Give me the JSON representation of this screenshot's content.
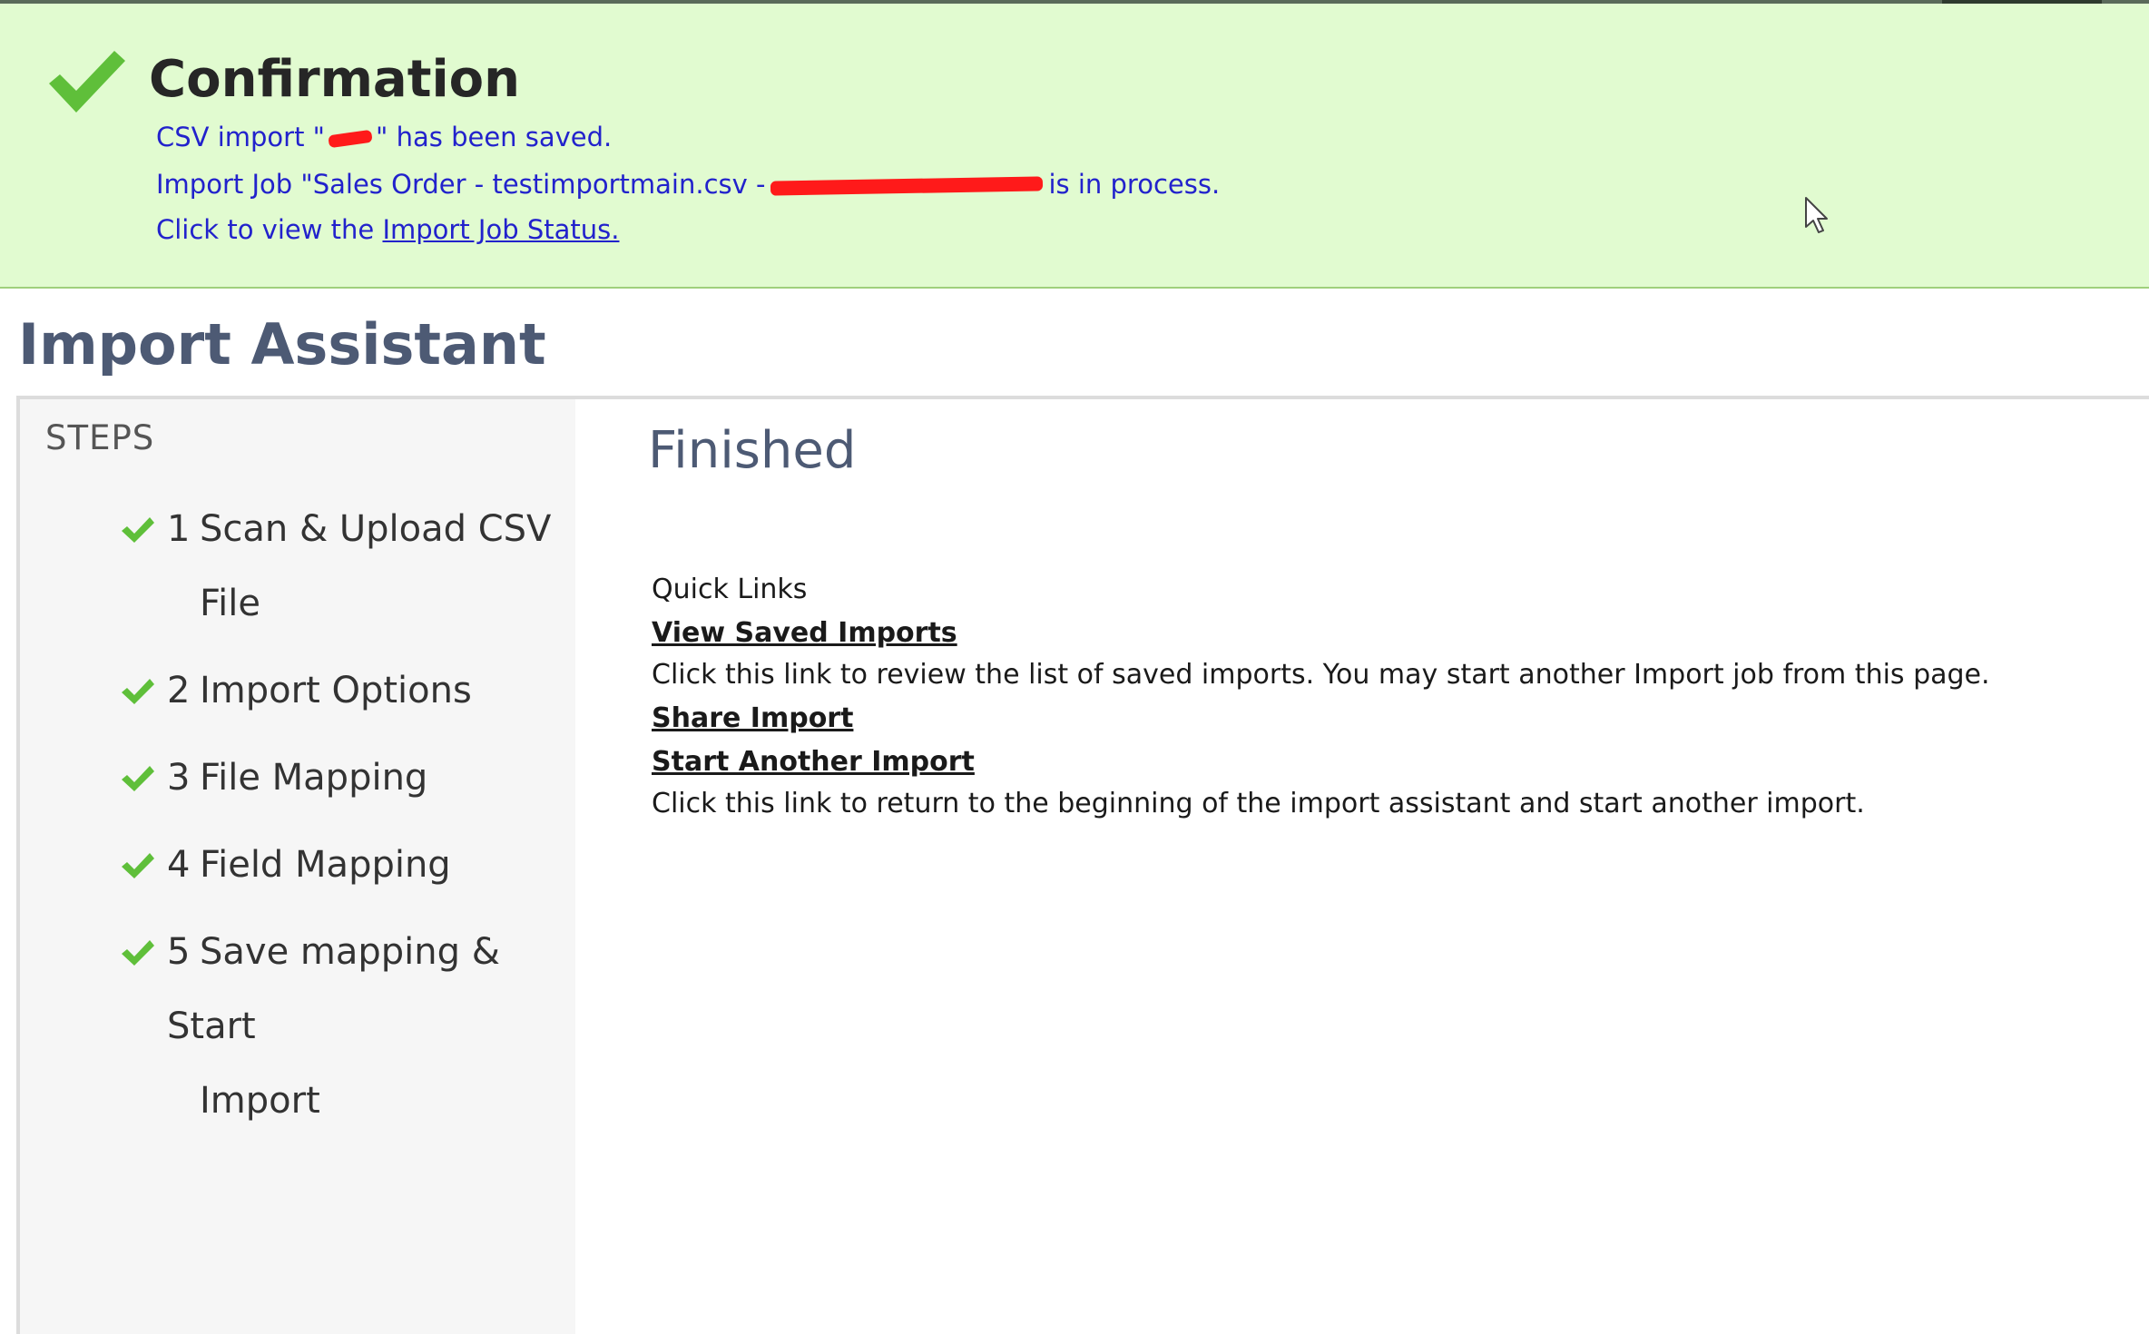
{
  "confirmation": {
    "title": "Confirmation",
    "line1_prefix": "CSV import \"",
    "line1_suffix": "\" has been saved.",
    "line2_prefix": "Import Job \"Sales Order - testimportmain.csv -",
    "line2_suffix": "is in process.",
    "line3_prefix": "Click to view the ",
    "line3_link": "Import Job Status."
  },
  "page": {
    "title": "Import Assistant"
  },
  "steps": {
    "heading": "STEPS",
    "items": [
      {
        "number": "1",
        "label": "Scan & Upload CSV",
        "label_cont": "File"
      },
      {
        "number": "2",
        "label": "Import Options",
        "label_cont": ""
      },
      {
        "number": "3",
        "label": "File Mapping",
        "label_cont": ""
      },
      {
        "number": "4",
        "label": "Field Mapping",
        "label_cont": ""
      },
      {
        "number": "5",
        "label": "Save mapping & Start",
        "label_cont": "Import"
      }
    ]
  },
  "main": {
    "title": "Finished",
    "quick_links_heading": "Quick Links",
    "view_saved_imports": "View Saved Imports",
    "view_saved_imports_desc": "Click this link to review the list of saved imports. You may start another Import job from this page.",
    "share_import": "Share Import",
    "start_another_import": "Start Another Import",
    "start_another_import_desc": "Click this link to return to the beginning of the import assistant and start another import."
  },
  "colors": {
    "banner_bg": "#e1fbd0",
    "banner_text": "#2222cc",
    "check_green": "#5fbf3a",
    "title_slate": "#4d5a74",
    "steps_bg": "#f6f6f6",
    "redaction": "#ff1a1a"
  }
}
